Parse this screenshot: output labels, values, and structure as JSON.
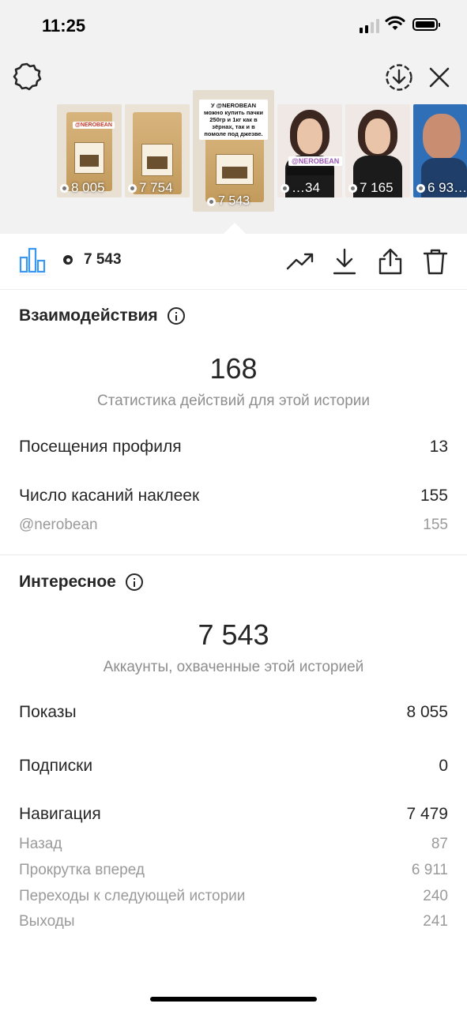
{
  "status_bar": {
    "time": "11:25"
  },
  "stories": [
    {
      "views": "8 005"
    },
    {
      "views": "7 754"
    },
    {
      "views": "7 543",
      "selected": true,
      "sticker_text": "У @NEROBEAN можно купить пачки 250гр и 1кг как в зёрнах, так и в помоле под джезве.",
      "tag": "@NEROBEAN"
    },
    {
      "views": "…34",
      "tag": "@NEROBEAN"
    },
    {
      "views": "7 165"
    },
    {
      "views": "6 93…"
    }
  ],
  "toolbar": {
    "views": "7 543"
  },
  "interactions": {
    "title": "Взаимодействия",
    "total": "168",
    "caption": "Статистика действий для этой истории",
    "rows": [
      {
        "label": "Посещения профиля",
        "value": "13"
      },
      {
        "label": "Число касаний наклеек",
        "value": "155"
      }
    ],
    "sub_rows": [
      {
        "label": "@nerobean",
        "value": "155"
      }
    ]
  },
  "discovery": {
    "title": "Интересное",
    "total": "7 543",
    "caption": "Аккаунты, охваченные этой историей",
    "rows": [
      {
        "label": "Показы",
        "value": "8 055"
      },
      {
        "label": "Подписки",
        "value": "0"
      },
      {
        "label": "Навигация",
        "value": "7 479"
      }
    ],
    "sub_rows": [
      {
        "label": "Назад",
        "value": "87"
      },
      {
        "label": "Прокрутка вперед",
        "value": "6 911"
      },
      {
        "label": "Переходы к следующей истории",
        "value": "240"
      },
      {
        "label": "Выходы",
        "value": "241"
      }
    ]
  }
}
